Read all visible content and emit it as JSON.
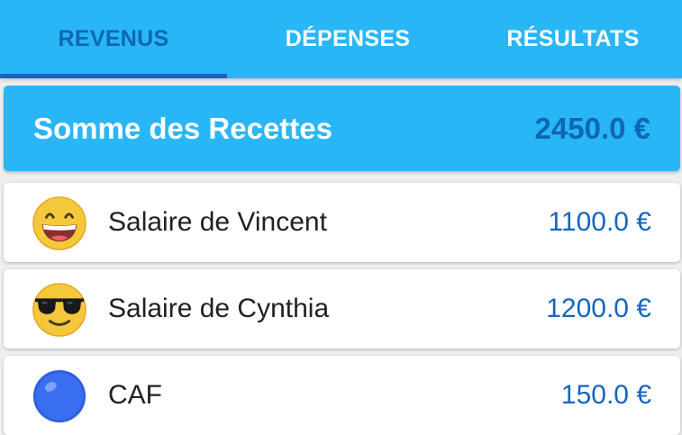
{
  "tabs": [
    {
      "label": "REVENUS",
      "active": true
    },
    {
      "label": "DÉPENSES",
      "active": false
    },
    {
      "label": "RÉSULTATS",
      "active": false
    }
  ],
  "summary": {
    "label": "Somme des Recettes",
    "value": "2450.0 €"
  },
  "items": [
    {
      "label": "Salaire de Vincent",
      "amount": "1100.0 €",
      "icon": "grinning-face-icon"
    },
    {
      "label": "Salaire de Cynthia",
      "amount": "1200.0 €",
      "icon": "sunglasses-face-icon"
    },
    {
      "label": "CAF",
      "amount": "150.0 €",
      "icon": "blue-circle-icon"
    }
  ],
  "colors": {
    "primary": "#29b6f6",
    "accent": "#1565c0",
    "active_tab_text": "#0d67b5",
    "background": "#eeeeee"
  }
}
